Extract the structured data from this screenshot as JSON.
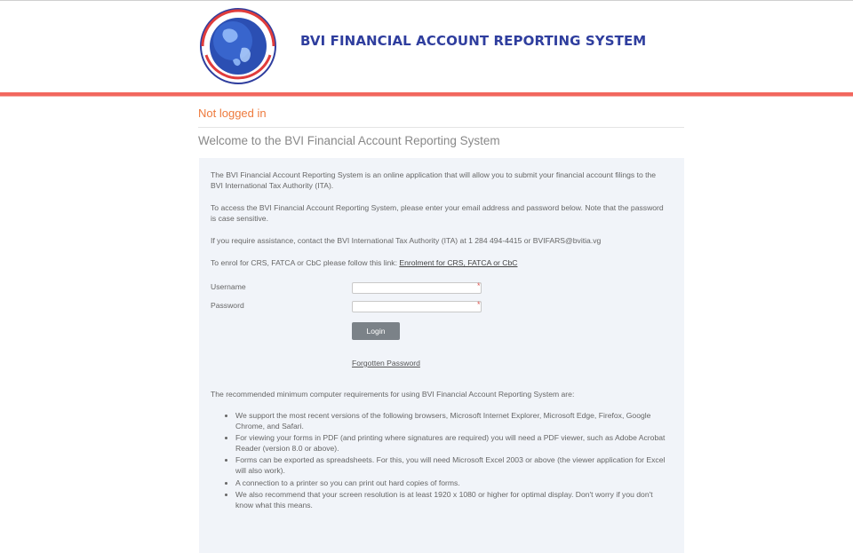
{
  "header": {
    "title": "BVI FINANCIAL ACCOUNT REPORTING SYSTEM",
    "logo_icon": "globe-seal-icon",
    "accent_color": "#f2675e",
    "title_color": "#2f3e9e"
  },
  "status": {
    "text": "Not logged in",
    "color": "#ee7a3d"
  },
  "welcome": "Welcome to the BVI Financial Account Reporting System",
  "intro": {
    "p1": "The BVI Financial Account Reporting System is an online application that will allow you to submit your financial account filings to the BVI International Tax Authority (ITA).",
    "p2": "To access the BVI Financial Account Reporting System, please enter your email address and password below. Note that the password is case sensitive.",
    "p3": "If you require assistance, contact the BVI International Tax Authority (ITA) at 1 284 494-4415 or BVIFARS@bvitia.vg",
    "p4_prefix": "To enrol for CRS, FATCA or CbC please follow this link: ",
    "p4_link": "Enrolment for CRS, FATCA or CbC"
  },
  "form": {
    "username_label": "Username",
    "password_label": "Password",
    "username_value": "",
    "password_value": "",
    "required_marker": "*",
    "login_label": "Login",
    "forgot_label": "Forgotten Password"
  },
  "requirements": {
    "intro": "The recommended minimum computer requirements for using BVI Financial Account Reporting System are:",
    "items": [
      "We support the most recent versions of the following browsers, Microsoft Internet Explorer, Microsoft Edge, Firefox, Google Chrome, and Safari.",
      "For viewing your forms in PDF (and printing where signatures are required) you will need a PDF viewer, such as Adobe Acrobat Reader (version 8.0 or above).",
      "Forms can be exported as spreadsheets. For this, you will need Microsoft Excel 2003 or above (the viewer application for Excel will also work).",
      "A connection to a printer so you can print out hard copies of forms.",
      "We also recommend that your screen resolution is at least 1920 x 1080 or higher for optimal display. Don't worry if you don't know what this means."
    ]
  }
}
